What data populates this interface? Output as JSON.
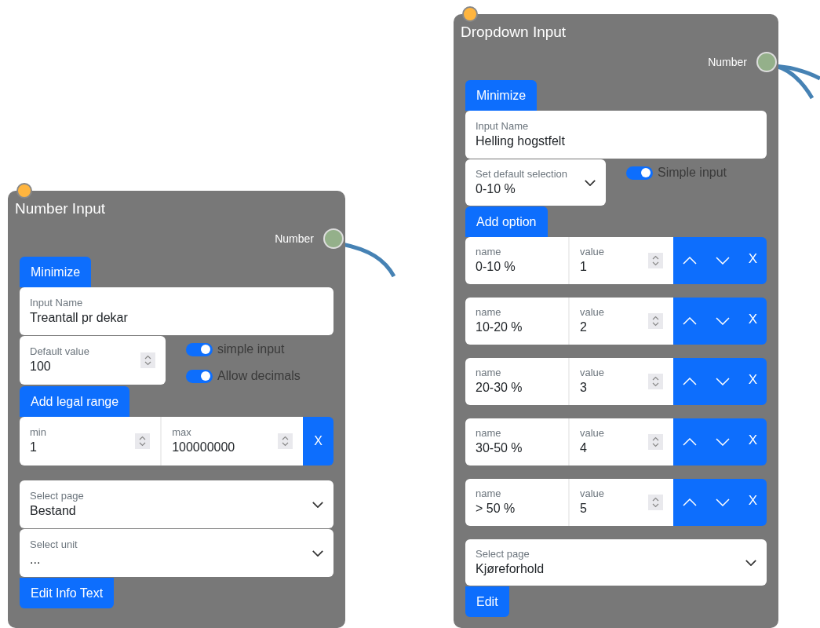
{
  "nodes": [
    {
      "kind": "number",
      "title": "Number Input",
      "output": "Number",
      "minimize": "Minimize",
      "input_name": {
        "label": "Input Name",
        "value": "Treantall pr dekar"
      },
      "default_value": {
        "label": "Default value",
        "value": "100"
      },
      "toggles": [
        {
          "label": "simple input",
          "on": true
        },
        {
          "label": "Allow decimals",
          "on": true
        }
      ],
      "range_button": "Add legal range",
      "range": {
        "min_label": "min",
        "min": "1",
        "max_label": "max",
        "max": "100000000",
        "remove": "X"
      },
      "selects": [
        {
          "label": "Select page",
          "value": "Bestand"
        },
        {
          "label": "Select unit",
          "value": "..."
        }
      ],
      "footer_button": "Edit Info Text"
    },
    {
      "kind": "dropdown",
      "title": "Dropdown Input",
      "output": "Number",
      "minimize": "Minimize",
      "input_name": {
        "label": "Input Name",
        "value": "Helling hogstfelt"
      },
      "default_selection": {
        "label": "Set default selection",
        "value": "0-10 %"
      },
      "toggles": [
        {
          "label": "Simple input",
          "on": true
        }
      ],
      "add_option": "Add option",
      "options": [
        {
          "name_label": "name",
          "name": "0-10 %",
          "value_label": "value",
          "value": "1",
          "remove": "X"
        },
        {
          "name_label": "name",
          "name": "10-20 %",
          "value_label": "value",
          "value": "2",
          "remove": "X"
        },
        {
          "name_label": "name",
          "name": "20-30 %",
          "value_label": "value",
          "value": "3",
          "remove": "X"
        },
        {
          "name_label": "name",
          "name": "30-50 %",
          "value_label": "value",
          "value": "4",
          "remove": "X"
        },
        {
          "name_label": "name",
          "name": "> 50 %",
          "value_label": "value",
          "value": "5",
          "remove": "X"
        }
      ],
      "selects": [
        {
          "label": "Select page",
          "value": "Kjøreforhold"
        }
      ],
      "footer_button": "Edit"
    }
  ]
}
